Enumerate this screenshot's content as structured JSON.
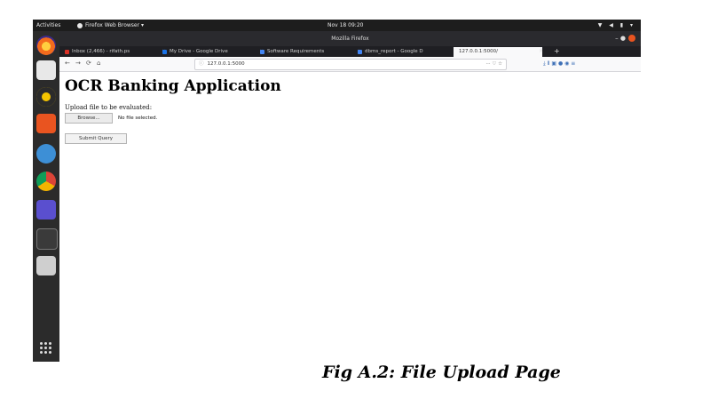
{
  "topbar": {
    "activities": "Activities",
    "app_name": "Firefox Web Browser ▾",
    "clock": "Nov 18 09:20",
    "tray": "▼ ◀ ▮ ▾"
  },
  "window": {
    "title": "Mozilla Firefox",
    "controls": "– ●"
  },
  "tabs": [
    {
      "label": "Inbox (2,466) - rifath.ps",
      "close": "×",
      "color": "#d93025"
    },
    {
      "label": "My Drive - Google Drive",
      "close": "×",
      "color": "#1a73e8"
    },
    {
      "label": "Software Requirements",
      "close": "×",
      "color": "#4285f4"
    },
    {
      "label": "dbms_report - Google D",
      "close": "×",
      "color": "#4285f4"
    },
    {
      "label": "127.0.0.1:5000/",
      "close": "×",
      "color": ""
    }
  ],
  "tab_overflow": "×",
  "tab_plus": "+",
  "nav": {
    "back": "←",
    "forward": "→",
    "reload": "⟳",
    "home": "⌂",
    "url_prefix": "ⓘ",
    "url": "127.0.0.1:5000",
    "url_actions": "···  ♡  ☆",
    "toolbar_icons": "⤓  Ⅱ  ▣  ●  ◉  ≡"
  },
  "page": {
    "heading": "OCR Banking Application",
    "upload_label": "Upload file to be evaluated:",
    "browse_button": "Browse...",
    "no_file": "No file selected.",
    "submit_button": "Submit Query"
  },
  "caption": "Fig A.2: File Upload Page",
  "colors": {
    "dock": "#2b2b2b",
    "topbar": "#1d1d1d",
    "accent": "#e95420"
  }
}
